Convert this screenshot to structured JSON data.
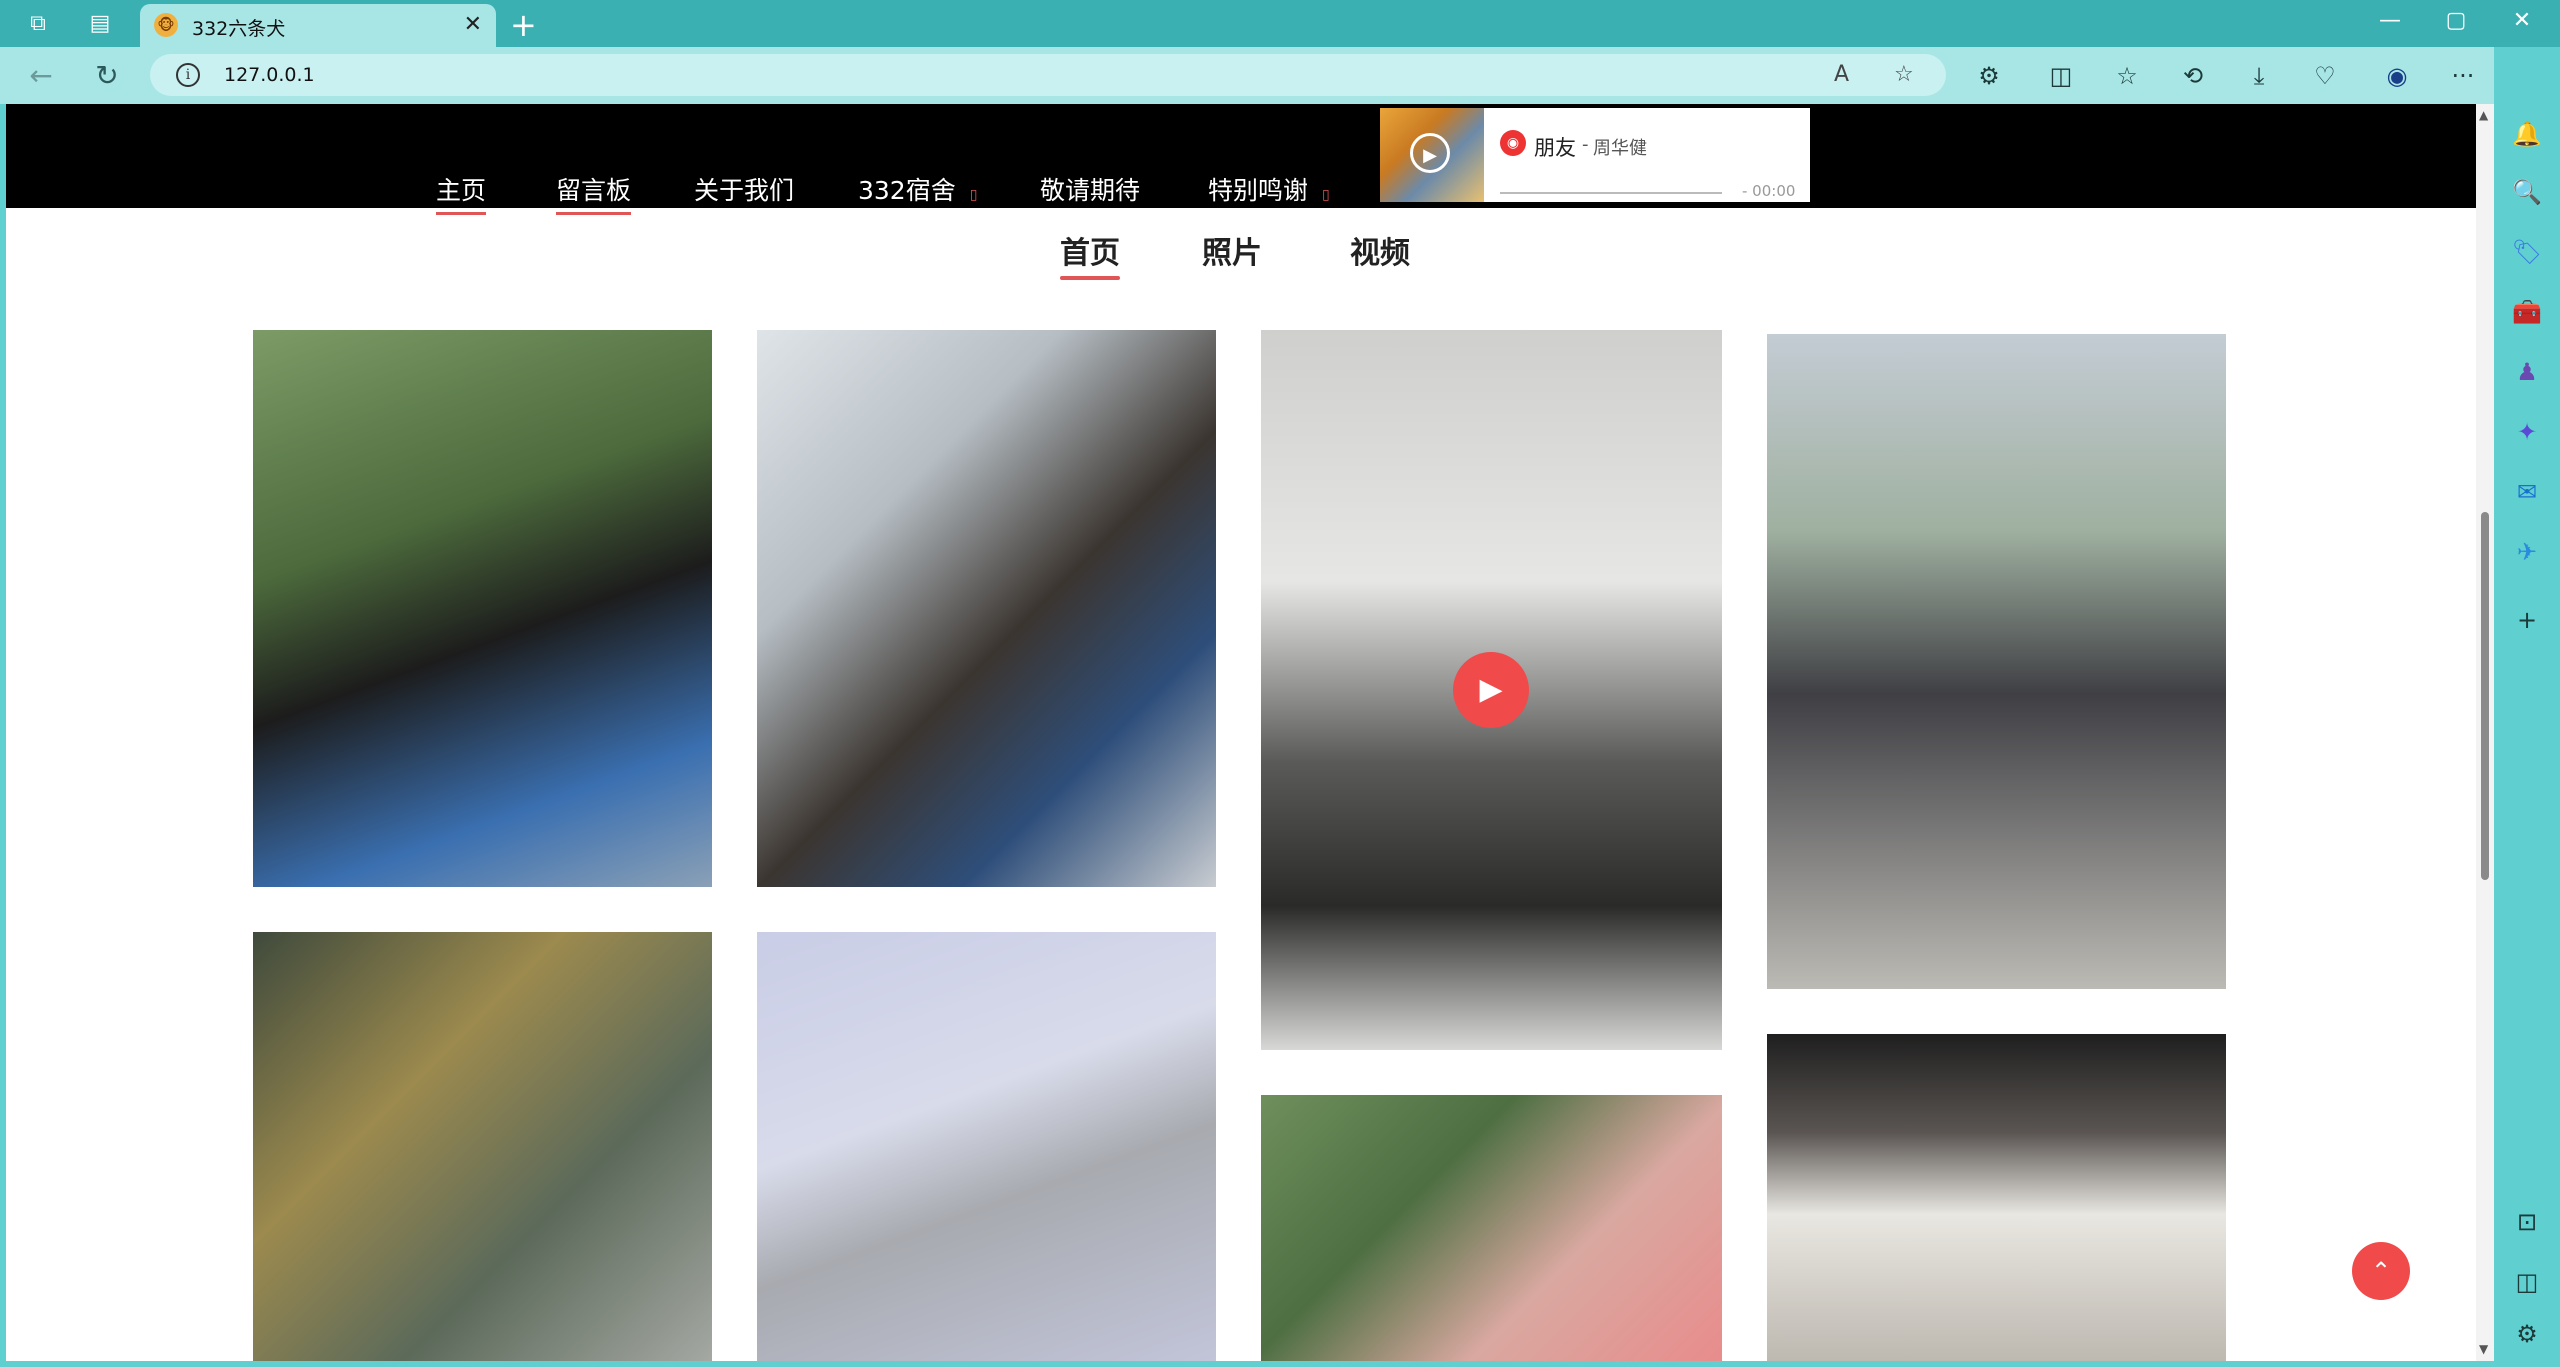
{
  "browser": {
    "tab_title": "332六条犬",
    "tab_favicon": "🐵",
    "address": "127.0.0.1",
    "tab_close": "✕",
    "new_tab": "+",
    "win_min": "—",
    "win_max": "▢",
    "win_close": "✕",
    "icons": {
      "workspaces": "⧉",
      "tab_actions": "▤",
      "back": "←",
      "refresh": "↻",
      "info": "i",
      "read_aloud": "A",
      "favorite_star": "☆",
      "extensions": "⚙",
      "split_screen": "◫",
      "favorites": "☆",
      "history": "⟲",
      "downloads": "⤓",
      "performance": "♡",
      "profile": "◉",
      "more": "···",
      "copilot": "✦"
    }
  },
  "header": {
    "nav": [
      {
        "label": "主页",
        "active": true
      },
      {
        "label": "留言板",
        "active": true
      },
      {
        "label": "关于我们",
        "active": false
      },
      {
        "label": "332宿舍",
        "active": false,
        "caret": "▯"
      },
      {
        "label": "敬请期待",
        "active": false
      },
      {
        "label": "特别鸣谢",
        "active": false,
        "caret": "▯"
      }
    ]
  },
  "music_player": {
    "song": "朋友",
    "dash": "-",
    "artist": "周华健",
    "time": "- 00:00",
    "play_icon": "▶",
    "logo_icon": "◉"
  },
  "subnav": [
    {
      "label": "首页",
      "active": true
    },
    {
      "label": "照片",
      "active": false
    },
    {
      "label": "视频",
      "active": false
    }
  ],
  "gallery": {
    "video_play_icon": "▶",
    "items": [
      {
        "kind": "photo",
        "subject": "student-looking-up-outdoors",
        "tint": "#5d7a4f"
      },
      {
        "kind": "photo",
        "subject": "student-with-earbuds-dorm",
        "tint": "#7b8894"
      },
      {
        "kind": "video",
        "subject": "student-at-whiteboard",
        "tint": "#6e6f6c"
      },
      {
        "kind": "photo",
        "subject": "students-walking-by-scooters",
        "tint": "#9aa2a6"
      },
      {
        "kind": "photo",
        "subject": "blurry-dorm-room",
        "tint": "#6b6a4f"
      },
      {
        "kind": "photo",
        "subject": "building-facade-sky",
        "tint": "#b9bfd8"
      },
      {
        "kind": "photo",
        "subject": "student-under-trees",
        "tint": "#6a8a5a"
      },
      {
        "kind": "photo",
        "subject": "dorm-bunk-storage",
        "tint": "#5a5552"
      }
    ]
  },
  "back_to_top_icon": "⌃",
  "scrollbar": {
    "up": "▲",
    "down": "▼"
  },
  "sidebar_icons": [
    {
      "name": "bell-icon",
      "glyph": "🔔",
      "color": "#2a6fd6"
    },
    {
      "name": "search-icon",
      "glyph": "🔍",
      "color": "#2a6fd6"
    },
    {
      "name": "tag-icon",
      "glyph": "🏷",
      "color": "#3a7ae0"
    },
    {
      "name": "toolbox-icon",
      "glyph": "🧰",
      "color": "#d84a3a"
    },
    {
      "name": "games-icon",
      "glyph": "♟",
      "color": "#6a4ab0"
    },
    {
      "name": "copilot-icon",
      "glyph": "✦",
      "color": "#5a4ad6"
    },
    {
      "name": "outlook-icon",
      "glyph": "✉",
      "color": "#1a6fd0"
    },
    {
      "name": "send-icon",
      "glyph": "✈",
      "color": "#2a8ae0"
    },
    {
      "name": "add-icon",
      "glyph": "+",
      "color": "#1d3a3a"
    },
    {
      "name": "screenshot-icon",
      "glyph": "⊡",
      "color": "#1d3a3a"
    },
    {
      "name": "sidebar-toggle-icon",
      "glyph": "◫",
      "color": "#1d3a3a"
    },
    {
      "name": "settings-icon",
      "glyph": "⚙",
      "color": "#1d3a3a"
    }
  ]
}
